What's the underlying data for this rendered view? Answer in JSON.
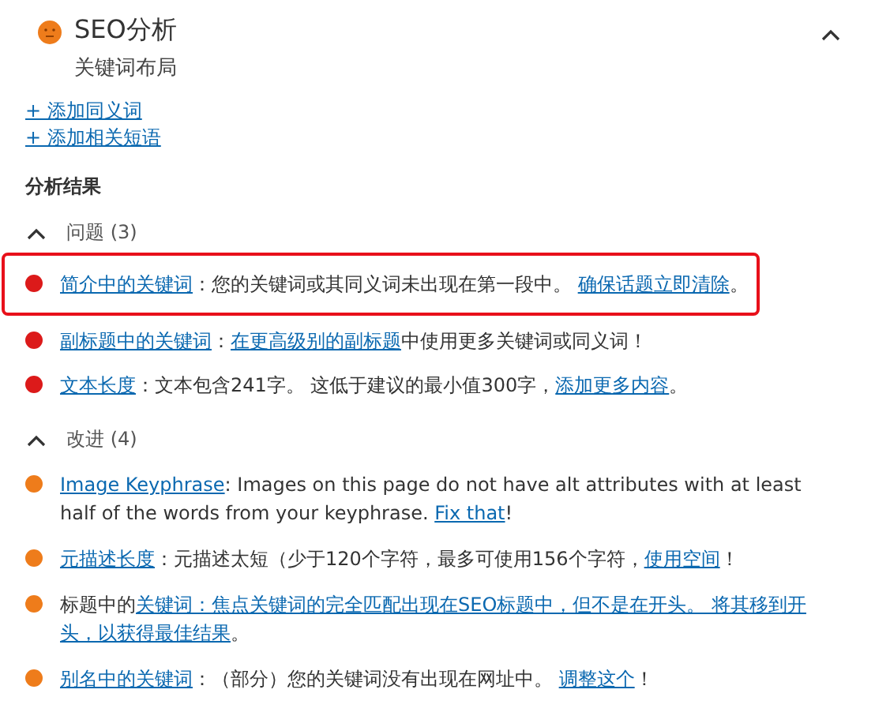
{
  "panel": {
    "title": "SEO分析",
    "subtitle": "关键词布局",
    "expanded": true
  },
  "links": [
    "+ 添加同义词",
    "+ 添加相关短语"
  ],
  "results_heading": "分析结果",
  "groups": [
    {
      "label": "问题 (3)",
      "expanded": true,
      "items": [
        {
          "color": "#dc1a1a",
          "highlighted": true,
          "parts": [
            {
              "text": "简介中的关键词",
              "link": true
            },
            {
              "text": "：您的关键词或其同义词未出现在第一段中。 ",
              "link": false
            },
            {
              "text": "确保话题立即清除",
              "link": true
            },
            {
              "text": "。",
              "link": false
            }
          ]
        },
        {
          "color": "#dc1a1a",
          "highlighted": false,
          "parts": [
            {
              "text": "副标题中的关键词",
              "link": true
            },
            {
              "text": "：",
              "link": false
            },
            {
              "text": "在更高级别的副标题",
              "link": true
            },
            {
              "text": "中使用更多关键词或同义词！",
              "link": false
            }
          ]
        },
        {
          "color": "#dc1a1a",
          "highlighted": false,
          "parts": [
            {
              "text": "文本长度",
              "link": true
            },
            {
              "text": "：文本包含241字。 这低于建议的最小值300字，",
              "link": false
            },
            {
              "text": "添加更多内容",
              "link": true
            },
            {
              "text": "。",
              "link": false
            }
          ]
        }
      ]
    },
    {
      "label": "改进 (4)",
      "expanded": true,
      "items": [
        {
          "color": "#ee7c1b",
          "highlighted": false,
          "parts": [
            {
              "text": "Image Keyphrase",
              "link": true
            },
            {
              "text": ": Images on this page do not have alt attributes with at least half of the words from your keyphrase. ",
              "link": false
            },
            {
              "text": "Fix that",
              "link": true
            },
            {
              "text": "!",
              "link": false
            }
          ]
        },
        {
          "color": "#ee7c1b",
          "highlighted": false,
          "parts": [
            {
              "text": "元描述长度",
              "link": true
            },
            {
              "text": "：元描述太短（少于120个字符，最多可使用156个字符，",
              "link": false
            },
            {
              "text": "使用空间",
              "link": true
            },
            {
              "text": "！",
              "link": false
            }
          ]
        },
        {
          "color": "#ee7c1b",
          "highlighted": false,
          "parts": [
            {
              "text": "标题中的",
              "link": false
            },
            {
              "text": "关键词：焦点关键词的完全匹配出现在SEO标题中，但不是在开头。 将其移到开",
              "link": true
            },
            {
              "text": "头，以获得最佳结果",
              "link": true
            },
            {
              "text": "。",
              "link": false
            }
          ]
        },
        {
          "color": "#ee7c1b",
          "highlighted": false,
          "parts": [
            {
              "text": "别名中的关键词",
              "link": true
            },
            {
              "text": "：（部分）您的关键词没有出现在网址中。 ",
              "link": false
            },
            {
              "text": "调整这个",
              "link": true
            },
            {
              "text": "！",
              "link": false
            }
          ]
        }
      ]
    }
  ]
}
